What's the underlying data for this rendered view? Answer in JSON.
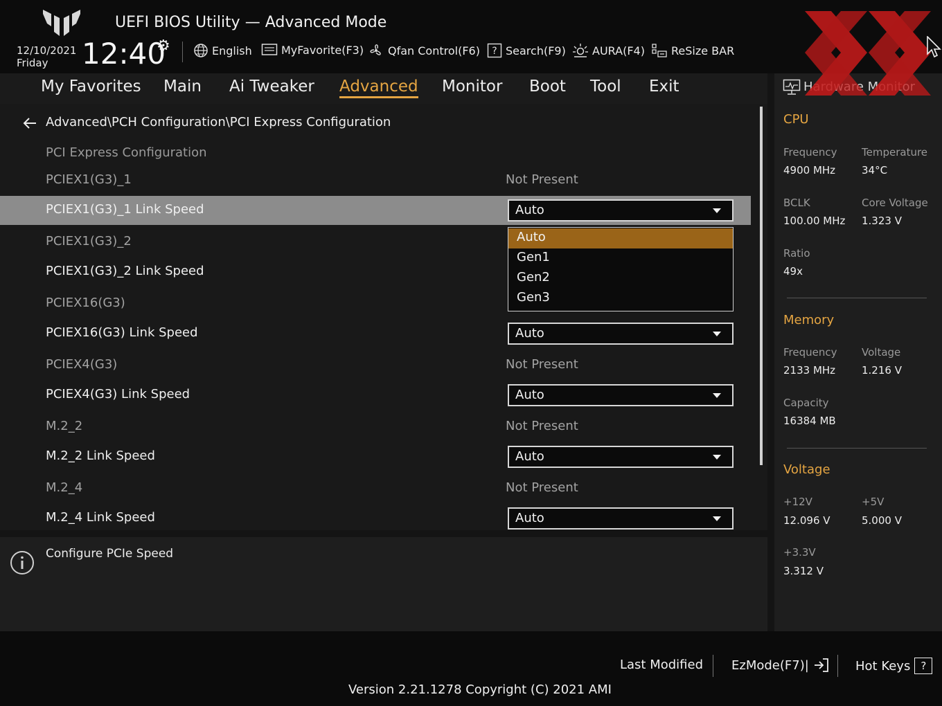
{
  "header": {
    "title": "UEFI BIOS Utility — Advanced Mode",
    "date": "12/10/2021",
    "day": "Friday",
    "time": "12:40",
    "buttons": {
      "language": "English",
      "myfavorite": "MyFavorite(F3)",
      "qfan": "Qfan Control(F6)",
      "search": "Search(F9)",
      "aura": "AURA(F4)",
      "resizebar": "ReSize BAR"
    }
  },
  "nav": {
    "tabs": [
      "My Favorites",
      "Main",
      "Ai Tweaker",
      "Advanced",
      "Monitor",
      "Boot",
      "Tool",
      "Exit"
    ],
    "active": "Advanced"
  },
  "main": {
    "breadcrumb": "Advanced\\PCH Configuration\\PCI Express Configuration",
    "section_title": "PCI Express Configuration",
    "rows": [
      {
        "label": "PCIEX1(G3)_1",
        "value": "Not Present"
      },
      {
        "label": "PCIEX1(G3)_1 Link Speed",
        "value": "Auto"
      },
      {
        "label": "PCIEX1(G3)_2",
        "value": ""
      },
      {
        "label": "PCIEX1(G3)_2 Link Speed",
        "value": ""
      },
      {
        "label": "PCIEX16(G3)",
        "value": ""
      },
      {
        "label": "PCIEX16(G3) Link Speed",
        "value": "Auto"
      },
      {
        "label": "PCIEX4(G3)",
        "value": "Not Present"
      },
      {
        "label": "PCIEX4(G3) Link Speed",
        "value": "Auto"
      },
      {
        "label": "M.2_2",
        "value": "Not Present"
      },
      {
        "label": "M.2_2 Link Speed",
        "value": "Auto"
      },
      {
        "label": "M.2_4",
        "value": "Not Present"
      },
      {
        "label": "M.2_4 Link Speed",
        "value": "Auto"
      }
    ],
    "dropdown_options": [
      "Auto",
      "Gen1",
      "Gen2",
      "Gen3"
    ],
    "dropdown_selected": "Auto"
  },
  "info": {
    "text": "Configure PCIe Speed"
  },
  "hardware_monitor": {
    "title": "Hardware Monitor",
    "cpu": {
      "heading": "CPU",
      "frequency_label": "Frequency",
      "frequency": "4900 MHz",
      "temperature_label": "Temperature",
      "temperature": "34°C",
      "bclk_label": "BCLK",
      "bclk": "100.00 MHz",
      "core_voltage_label": "Core Voltage",
      "core_voltage": "1.323 V",
      "ratio_label": "Ratio",
      "ratio": "49x"
    },
    "memory": {
      "heading": "Memory",
      "frequency_label": "Frequency",
      "frequency": "2133 MHz",
      "voltage_label": "Voltage",
      "voltage": "1.216 V",
      "capacity_label": "Capacity",
      "capacity": "16384 MB"
    },
    "voltage": {
      "heading": "Voltage",
      "v12_label": "+12V",
      "v12": "12.096 V",
      "v5_label": "+5V",
      "v5": "5.000 V",
      "v33_label": "+3.3V",
      "v33": "3.312 V"
    }
  },
  "footer": {
    "last_modified": "Last Modified",
    "ezmode": "EzMode(F7)|",
    "hotkeys": "Hot Keys",
    "hotkeys_glyph": "?",
    "version": "Version 2.21.1278 Copyright (C) 2021 AMI"
  },
  "colors": {
    "accent": "#e5a542",
    "selected_option": "#9a6418",
    "highlight_row": "#8c8c8c",
    "watermark": "#c41a1a"
  }
}
